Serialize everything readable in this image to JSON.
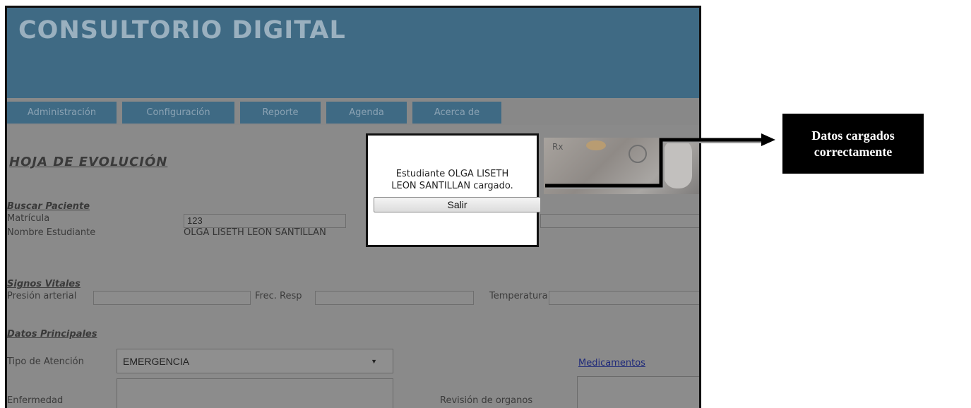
{
  "app": {
    "title": "CONSULTORIO DIGITAL"
  },
  "nav": {
    "items": [
      {
        "label": "Administración"
      },
      {
        "label": "Configuración"
      },
      {
        "label": "Reporte"
      },
      {
        "label": "Agenda"
      },
      {
        "label": "Acerca de"
      }
    ]
  },
  "page": {
    "title": "HOJA DE EVOLUCIÓN"
  },
  "buscar": {
    "section_label": "Buscar Paciente",
    "matricula_label": "Matrícula",
    "matricula_value": "123",
    "nombre_label": "Nombre Estudiante",
    "nombre_value": "OLGA LISETH LEON SANTILLAN"
  },
  "signos": {
    "section_label": "Signos Vitales",
    "presion_label": "Presión arterial",
    "frec_label": "Frec. Resp",
    "temp_label": "Temperatura"
  },
  "datos": {
    "section_label": "Datos Principales",
    "tipo_label": "Tipo de Atención",
    "tipo_value": "EMERGENCIA",
    "medicamentos_link": "Medicamentos",
    "enfermedad_label": "Enfermedad",
    "revision_label": "Revisión de organos"
  },
  "banner": {
    "text": "Rx"
  },
  "dialog": {
    "message_line1": "Estudiante OLGA LISETH",
    "message_line2": "LEON SANTILLAN cargado.",
    "button_label": "Salir"
  },
  "callout": {
    "line1": "Datos cargados",
    "line2": "correctamente"
  },
  "colors": {
    "header_bg": "#3f6a84",
    "overlay_gray": "#8a8a8a",
    "callout_bg": "#000000"
  }
}
